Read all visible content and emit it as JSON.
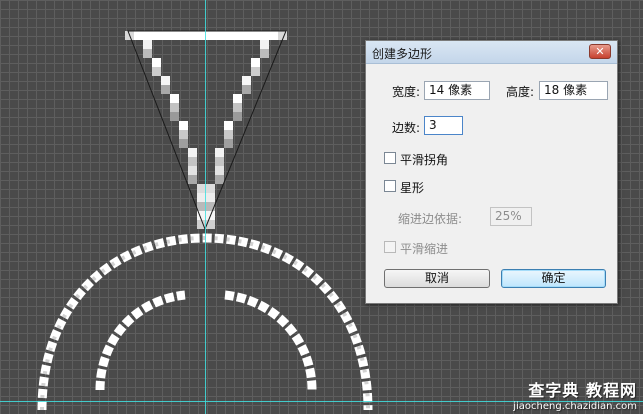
{
  "dialog": {
    "title": "创建多边形",
    "close_glyph": "✕",
    "width_label": "宽度:",
    "width_value": "14 像素",
    "height_label": "高度:",
    "height_value": "18 像素",
    "sides_label": "边数:",
    "sides_value": "3",
    "smooth_corners_label": "平滑拐角",
    "star_label": "星形",
    "indent_label": "缩进边依据:",
    "indent_value": "25%",
    "smooth_indents_label": "平滑缩进",
    "cancel_label": "取消",
    "ok_label": "确定"
  },
  "watermark": {
    "main": "查字典 教程网",
    "sub": "jiaocheng.chazidian.com"
  },
  "colors": {
    "guide": "#3fe0e0",
    "canvas": "#4a4a4a",
    "grid": "#5e5e5e",
    "shape_stroke": "#ffffff"
  }
}
